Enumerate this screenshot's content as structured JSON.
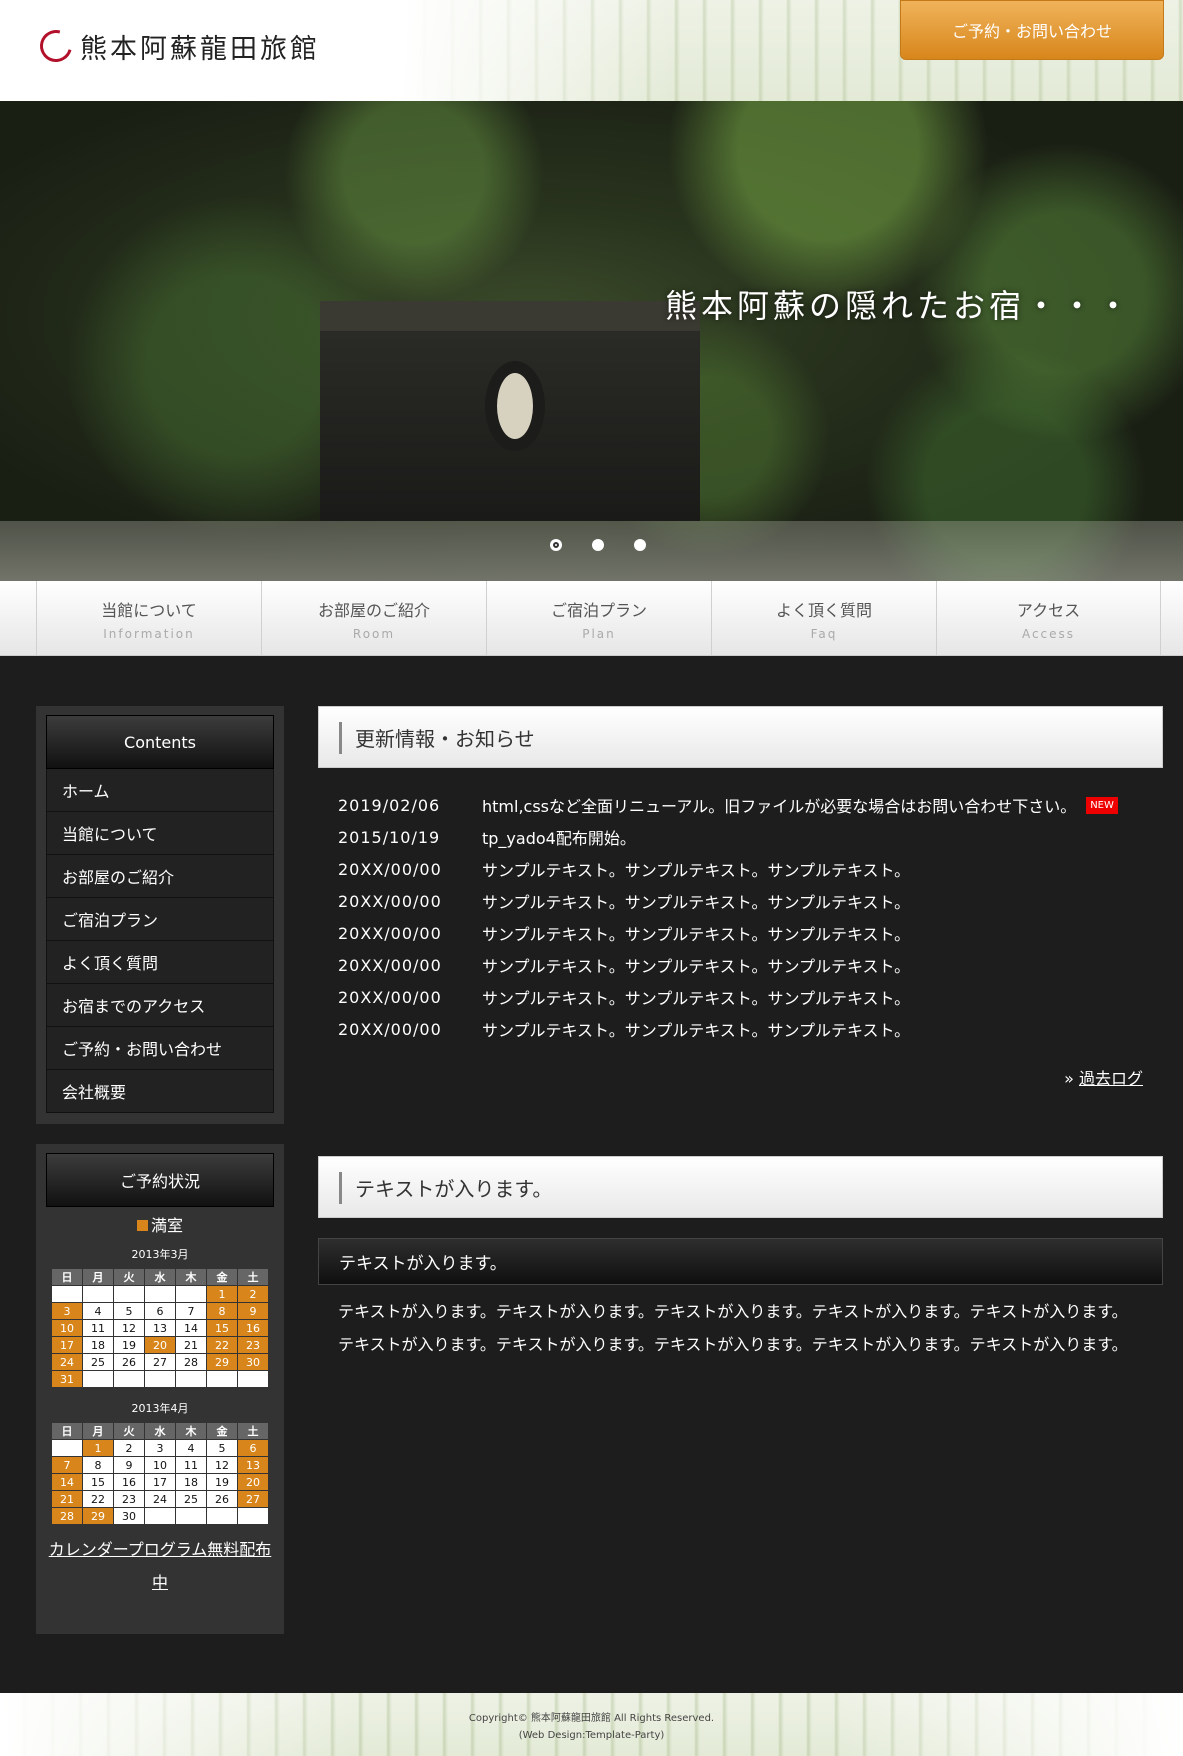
{
  "header": {
    "logo_text": "熊本阿蘇龍田旅館",
    "reserve_button": "ご予約・お問い合わせ"
  },
  "hero": {
    "caption": "熊本阿蘇の隠れたお宿・・・",
    "slide_count": 3,
    "active_slide": 1
  },
  "nav": {
    "items": [
      {
        "label": "当館について",
        "sub": "Information"
      },
      {
        "label": "お部屋のご紹介",
        "sub": "Room"
      },
      {
        "label": "ご宿泊プラン",
        "sub": "Plan"
      },
      {
        "label": "よく頂く質問",
        "sub": "Faq"
      },
      {
        "label": "アクセス",
        "sub": "Access"
      }
    ]
  },
  "sidebar": {
    "menu_title": "Contents",
    "menu_items": [
      "ホーム",
      "当館について",
      "お部屋のご紹介",
      "ご宿泊プラン",
      "よく頂く質問",
      "お宿までのアクセス",
      "ご予約・お問い合わせ",
      "会社概要"
    ],
    "calendar_title": "ご予約状況",
    "legend": "満室",
    "weekdays": [
      "日",
      "月",
      "火",
      "水",
      "木",
      "金",
      "土"
    ],
    "calendars": [
      {
        "caption": "2013年3月",
        "weeks": [
          [
            "",
            "",
            "",
            "",
            "",
            "1",
            "2"
          ],
          [
            "3",
            "4",
            "5",
            "6",
            "7",
            "8",
            "9"
          ],
          [
            "10",
            "11",
            "12",
            "13",
            "14",
            "15",
            "16"
          ],
          [
            "17",
            "18",
            "19",
            "20",
            "21",
            "22",
            "23"
          ],
          [
            "24",
            "25",
            "26",
            "27",
            "28",
            "29",
            "30"
          ],
          [
            "31",
            "",
            "",
            "",
            "",
            "",
            ""
          ]
        ],
        "full": [
          "1",
          "2",
          "3",
          "8",
          "9",
          "10",
          "15",
          "16",
          "17",
          "20",
          "22",
          "23",
          "24",
          "29",
          "30",
          "31"
        ]
      },
      {
        "caption": "2013年4月",
        "weeks": [
          [
            "",
            "1",
            "2",
            "3",
            "4",
            "5",
            "6"
          ],
          [
            "7",
            "8",
            "9",
            "10",
            "11",
            "12",
            "13"
          ],
          [
            "14",
            "15",
            "16",
            "17",
            "18",
            "19",
            "20"
          ],
          [
            "21",
            "22",
            "23",
            "24",
            "25",
            "26",
            "27"
          ],
          [
            "28",
            "29",
            "30",
            "",
            "",
            "",
            ""
          ]
        ],
        "full": [
          "1",
          "6",
          "7",
          "13",
          "14",
          "20",
          "21",
          "27",
          "28",
          "29"
        ]
      }
    ],
    "calendar_link": "カレンダープログラム無料配布中"
  },
  "news": {
    "heading": "更新情報・お知らせ",
    "items": [
      {
        "date": "2019/02/06",
        "text": "html,cssなど全面リニューアル。旧ファイルが必要な場合はお問い合わせ下さい。",
        "badge": "NEW"
      },
      {
        "date": "2015/10/19",
        "text": "tp_yado4配布開始。",
        "badge": ""
      },
      {
        "date": "20XX/00/00",
        "text": "サンプルテキスト。サンプルテキスト。サンプルテキスト。",
        "badge": ""
      },
      {
        "date": "20XX/00/00",
        "text": "サンプルテキスト。サンプルテキスト。サンプルテキスト。",
        "badge": ""
      },
      {
        "date": "20XX/00/00",
        "text": "サンプルテキスト。サンプルテキスト。サンプルテキスト。",
        "badge": ""
      },
      {
        "date": "20XX/00/00",
        "text": "サンプルテキスト。サンプルテキスト。サンプルテキスト。",
        "badge": ""
      },
      {
        "date": "20XX/00/00",
        "text": "サンプルテキスト。サンプルテキスト。サンプルテキスト。",
        "badge": ""
      },
      {
        "date": "20XX/00/00",
        "text": "サンプルテキスト。サンプルテキスト。サンプルテキスト。",
        "badge": ""
      }
    ],
    "past_log_prefix": "»",
    "past_log_link": "過去ログ"
  },
  "section": {
    "heading": "テキストが入ります。",
    "sub_heading": "テキストが入ります。",
    "body_lines": [
      "テキストが入ります。テキストが入ります。テキストが入ります。テキストが入ります。テキストが入ります。",
      "テキストが入ります。テキストが入ります。テキストが入ります。テキストが入ります。テキストが入ります。"
    ]
  },
  "footer": {
    "copyright": "Copyright© 熊本阿蘇龍田旅館 All Rights Reserved.",
    "credit": "(Web Design:Template-Party)"
  },
  "colors": {
    "accent": "#d8861b",
    "background": "#1d1d1d",
    "new_badge": "#ee0000"
  }
}
